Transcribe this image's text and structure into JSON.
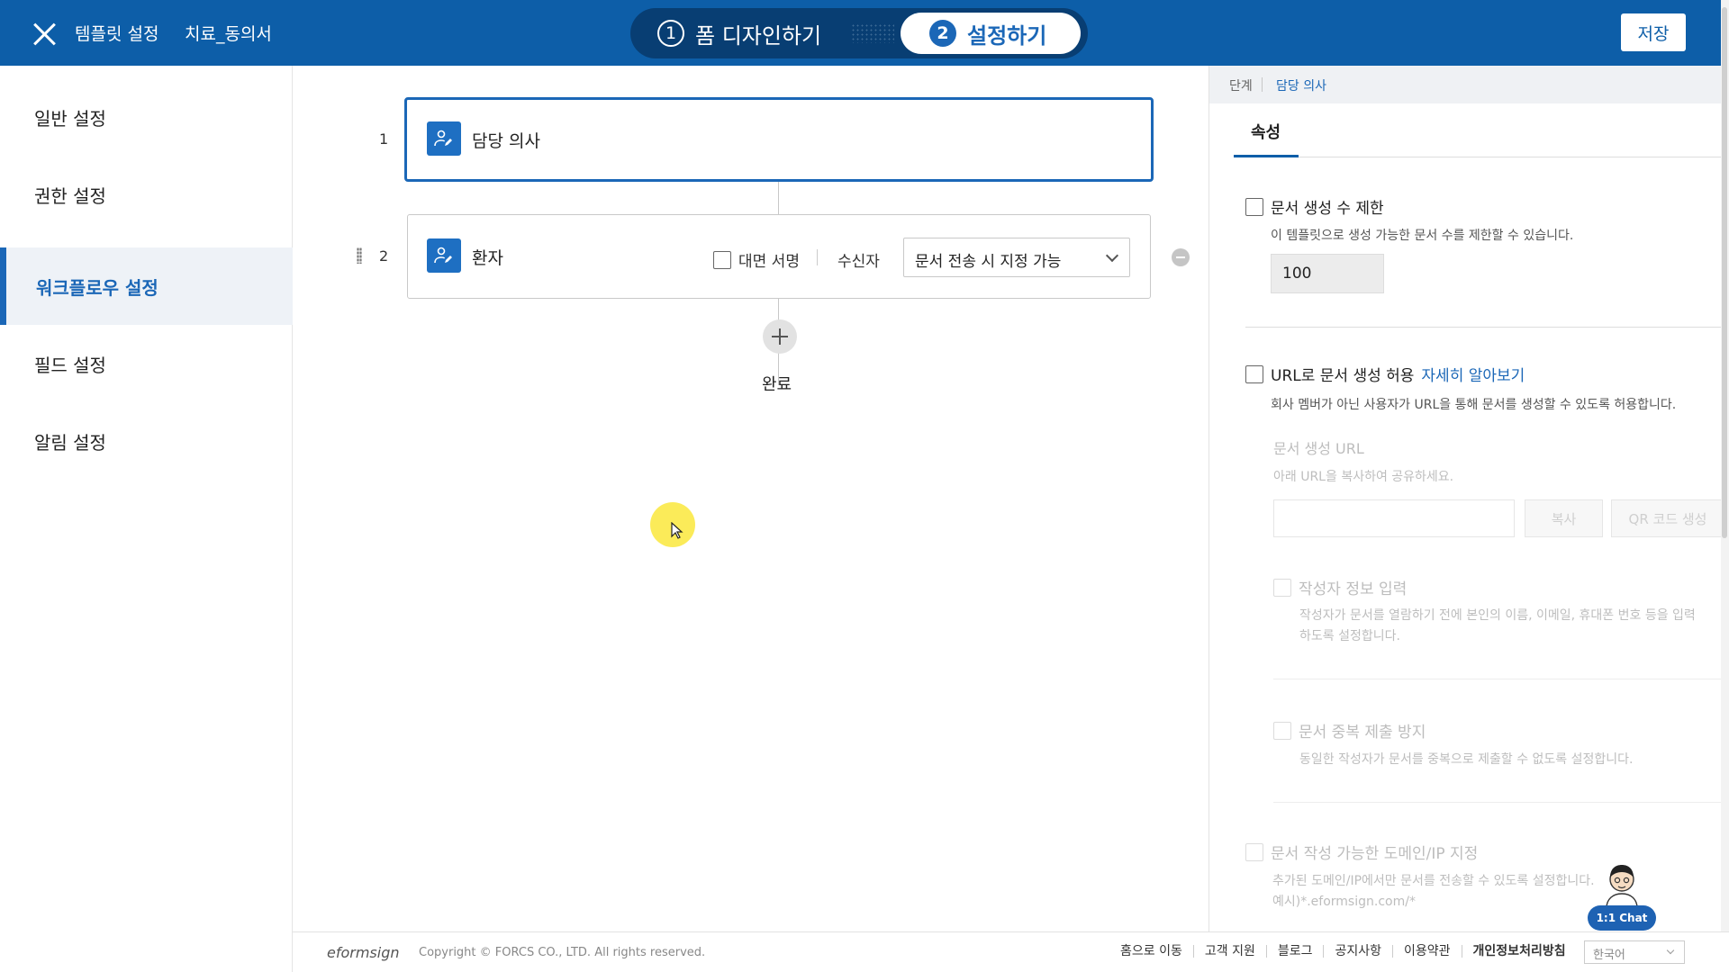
{
  "header": {
    "title": "템플릿 설정",
    "doc_name": "치료_동의서",
    "steps": [
      {
        "num": "1",
        "label": "폼 디자인하기"
      },
      {
        "num": "2",
        "label": "설정하기"
      }
    ],
    "save_label": "저장",
    "colors": {
      "bar": "#0d5ea8",
      "active_step": "#1b67b7"
    }
  },
  "sidebar": {
    "items": [
      {
        "label": "일반 설정"
      },
      {
        "label": "권한 설정"
      },
      {
        "label": "워크플로우 설정"
      },
      {
        "label": "필드 설정"
      },
      {
        "label": "알림 설정"
      }
    ],
    "active_index": 2
  },
  "workflow": {
    "nodes": [
      {
        "index": "1",
        "label": "담당 의사",
        "icon": "person-edit-icon"
      },
      {
        "index": "2",
        "label": "환자",
        "icon": "person-edit-icon"
      }
    ],
    "face_sign_label": "대면 서명",
    "recipient_label": "수신자",
    "recipient_select": "문서 전송 시 지정 가능",
    "end_label": "완료"
  },
  "panel": {
    "breadcrumb": [
      "단계",
      "담당 의사"
    ],
    "tab": "속성",
    "limit": {
      "label": "문서 생성 수 제한",
      "desc": "이 템플릿으로 생성 가능한 문서 수를 제한할 수 있습니다.",
      "value": "100"
    },
    "url": {
      "label": "URL로 문서 생성 허용",
      "link": "자세히 알아보기",
      "desc": "회사 멤버가 아닌 사용자가 URL을 통해 문서를 생성할 수 있도록 허용합니다.",
      "sub_title": "문서 생성 URL",
      "sub_desc": "아래 URL을 복사하여 공유하세요.",
      "copy_label": "복사",
      "qr_label": "QR 코드 생성"
    },
    "author_info": {
      "label": "작성자 정보 입력",
      "desc1": "작성자가 문서를 열람하기 전에 본인의 이름, 이메일, 휴대폰 번호 등을 입력",
      "desc2": "하도록 설정합니다."
    },
    "dup_prevent": {
      "label": "문서 중복 제출 방지",
      "desc": "동일한 작성자가 문서를 중복으로 제출할 수 없도록 설정합니다."
    },
    "domain": {
      "label": "문서 작성 가능한 도메인/IP 지정",
      "desc1": "추가된 도메인/IP에서만 문서를 전송할 수 있도록 설정합니다.",
      "desc2": "예시)*.eformsign.com/*"
    }
  },
  "chat": {
    "label": "1:1 Chat"
  },
  "footer": {
    "logo": "eformsign",
    "copyright": "Copyright © FORCS CO., LTD. All rights reserved.",
    "links": [
      "홈으로 이동",
      "고객 지원",
      "블로그",
      "공지사항",
      "이용약관",
      "개인정보처리방침"
    ],
    "language": "한국어"
  }
}
